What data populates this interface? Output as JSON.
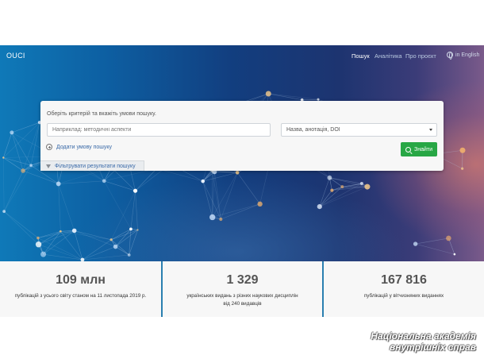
{
  "navbar": {
    "brand": "OUCI",
    "items": [
      {
        "label": "Пошук",
        "active": true
      },
      {
        "label": "Аналітика",
        "active": false
      },
      {
        "label": "Про проєкт",
        "active": false
      }
    ],
    "language": "in English",
    "language_icon": "globe-icon"
  },
  "search": {
    "intro": "Оберіть критерій та вкажіть умови пошуку.",
    "query_placeholder": "Наприклад: методичні аспекти",
    "query_value": "",
    "field_selected": "Назва, анотація, DOI",
    "add_condition_label": "Додати умову пошуку",
    "find_label": "Знайти",
    "filter_label": "Фільтрувати результати пошуку",
    "accent_color": "#28a745"
  },
  "stats": [
    {
      "value": "109 млн",
      "label": "публікацій з усього світу станом на 11 листопада 2019 р."
    },
    {
      "value": "1 329",
      "label": "українських видань з різних наукових дисциплін від 240 видавців"
    },
    {
      "value": "167 816",
      "label": "публікацій у вітчизняних виданнях"
    }
  ],
  "watermark": {
    "line1": "Національна академія",
    "line2": "внутрішніх справ"
  }
}
